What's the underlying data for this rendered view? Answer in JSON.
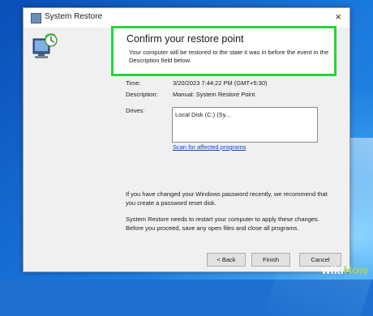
{
  "window": {
    "title": "System Restore",
    "close_glyph": "×"
  },
  "confirm": {
    "heading": "Confirm your restore point",
    "description": "Your computer will be restored to the state it was in before the event in the Description field below."
  },
  "details": {
    "time_label": "Time:",
    "time_value": "3/20/2023 7:44:22 PM (GMT+5:30)",
    "description_label": "Description:",
    "description_value": "Manual: System Restore Point",
    "drives_label": "Drives:",
    "drives_value": "Local Disk (C:) (Sy..."
  },
  "scan_link": "Scan for affected programs",
  "notes": {
    "password": "If you have changed your Windows password recently, we recommend that you create a password reset disk.",
    "restart": "System Restore needs to restart your computer to apply these changes. Before you proceed, save any open files and close all programs."
  },
  "buttons": {
    "back": "< Back",
    "finish": "Finish",
    "cancel": "Cancel"
  },
  "watermark": {
    "prefix": "wiki",
    "suffix": "How"
  },
  "colors": {
    "highlight_border": "#27d33b",
    "link": "#0b4fa8",
    "desktop": "#1a78dc"
  },
  "icons": [
    "system-restore-title-icon",
    "computer-restore-icon",
    "close-icon"
  ]
}
